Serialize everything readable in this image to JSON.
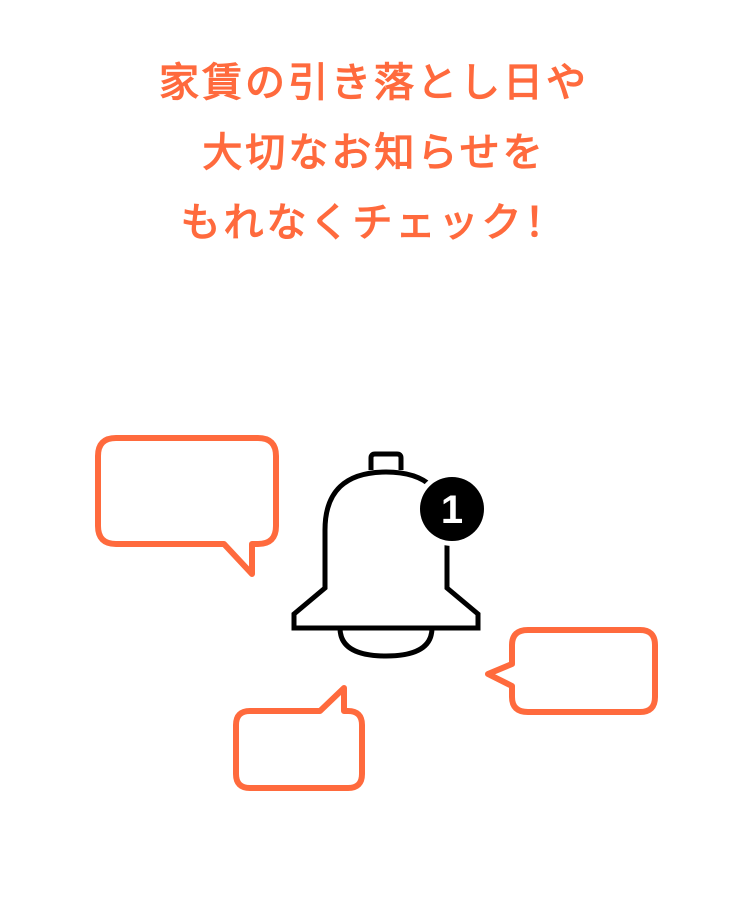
{
  "headline": {
    "lines": [
      "家賃の引き落とし日や",
      "大切なお知らせを",
      "もれなくチェック！"
    ],
    "color": "#ff6a3d"
  },
  "notification": {
    "icon": "bell-icon",
    "badge_count": "1",
    "badge_color": "#000000"
  },
  "speech_bubbles": {
    "icon": "speech-bubble-icon",
    "color": "#ff6a3d"
  }
}
